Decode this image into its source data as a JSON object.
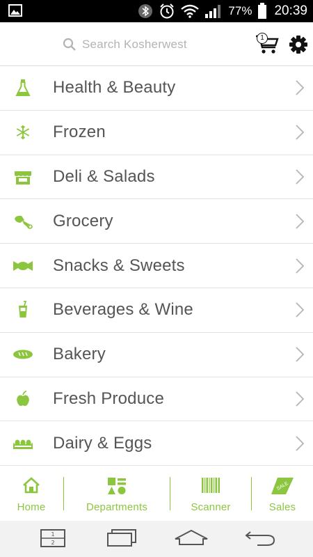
{
  "status_bar": {
    "battery_percent": "77%",
    "time": "20:39",
    "icons": [
      "gallery-icon",
      "bluetooth-icon",
      "alarm-icon",
      "wifi-icon",
      "signal-icon",
      "battery-icon"
    ]
  },
  "header": {
    "search_placeholder": "Search Kosherwest",
    "cart_count": "1",
    "icons": [
      "search-icon",
      "cart-icon",
      "gear-icon"
    ]
  },
  "categories": [
    {
      "label": "Health & Beauty",
      "icon": "flask-icon"
    },
    {
      "label": "Frozen",
      "icon": "snowflake-icon"
    },
    {
      "label": "Deli & Salads",
      "icon": "deli-counter-icon"
    },
    {
      "label": "Grocery",
      "icon": "hand-mixer-icon"
    },
    {
      "label": "Snacks & Sweets",
      "icon": "candy-icon"
    },
    {
      "label": "Beverages & Wine",
      "icon": "drink-cup-icon"
    },
    {
      "label": "Bakery",
      "icon": "bread-icon"
    },
    {
      "label": "Fresh Produce",
      "icon": "apple-icon"
    },
    {
      "label": "Dairy & Eggs",
      "icon": "egg-carton-icon"
    }
  ],
  "tabs": [
    {
      "label": "Home",
      "icon": "home-icon"
    },
    {
      "label": "Departments",
      "icon": "shapes-icon"
    },
    {
      "label": "Scanner",
      "icon": "barcode-icon"
    },
    {
      "label": "Sales",
      "icon": "sale-tag-icon",
      "badge": "SALE"
    }
  ],
  "colors": {
    "accent": "#8cc63f",
    "text": "#555555",
    "placeholder": "#b3b3b3",
    "divider": "#e3e3e3"
  }
}
